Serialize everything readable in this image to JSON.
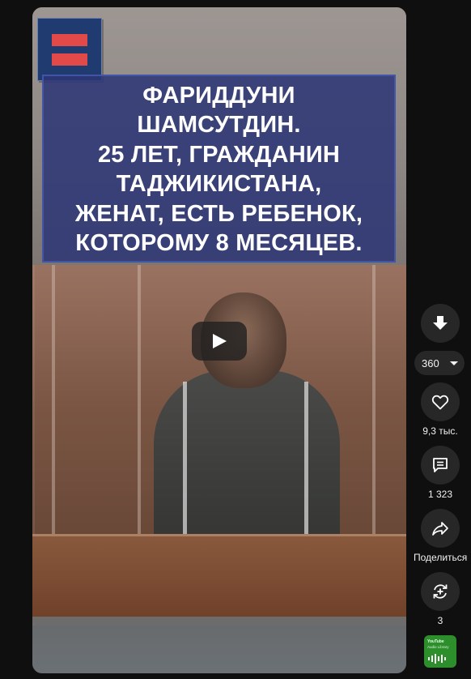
{
  "video": {
    "caption_lines": [
      "ФАРИДДУНИ",
      "ШАМСУТДИН.",
      "25 ЛЕТ, ГРАЖДАНИН",
      "ТАДЖИКИСТАНА,",
      "ЖЕНАТ, ЕСТЬ РЕБЕНОК,",
      "КОТОРОМУ 8 МЕСЯЦЕВ."
    ],
    "channel_logo_icon": "equals-flag-logo-icon",
    "play_icon": "play-icon"
  },
  "actions": {
    "download_icon": "download-icon",
    "quality": {
      "value": "360",
      "icon": "chevron-down-icon"
    },
    "like": {
      "count": "9,3 тыс.",
      "icon": "heart-icon"
    },
    "comments": {
      "count": "1 323",
      "icon": "comment-icon"
    },
    "share": {
      "label": "Поделиться",
      "icon": "share-arrow-icon"
    },
    "remix": {
      "count": "3",
      "icon": "remix-icon"
    },
    "music": {
      "title": "YouTube",
      "subtitle": "Audio Library",
      "icon": "sound-wave-icon"
    }
  },
  "colors": {
    "background": "#0f0f0f",
    "button_bg": "#272727",
    "caption_bg": "#2c3676",
    "logo_bg": "#1f3b70",
    "logo_accent": "#e24a4a",
    "music_tile": "#2c8f2c"
  }
}
